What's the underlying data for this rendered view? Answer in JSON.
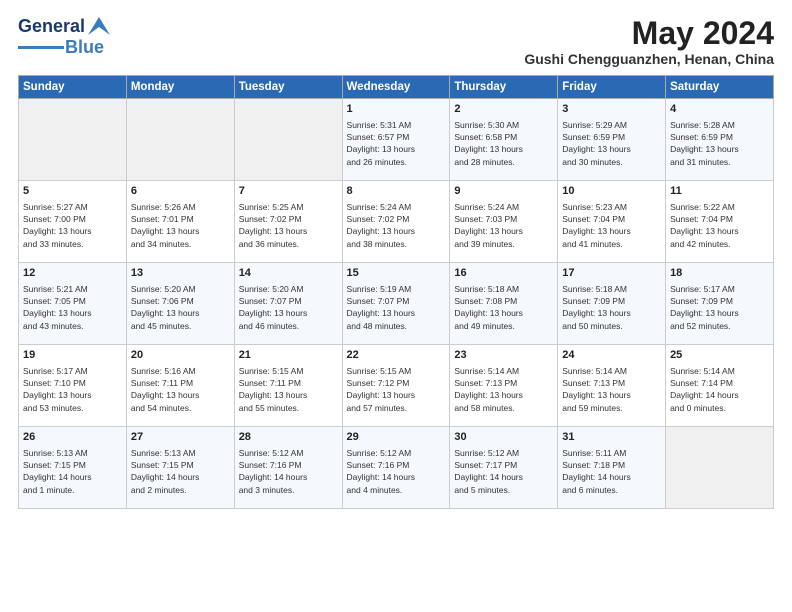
{
  "logo": {
    "general": "General",
    "blue": "Blue"
  },
  "header": {
    "month": "May 2024",
    "location": "Gushi Chengguanzhen, Henan, China"
  },
  "weekdays": [
    "Sunday",
    "Monday",
    "Tuesday",
    "Wednesday",
    "Thursday",
    "Friday",
    "Saturday"
  ],
  "weeks": [
    [
      {
        "day": "",
        "info": ""
      },
      {
        "day": "",
        "info": ""
      },
      {
        "day": "",
        "info": ""
      },
      {
        "day": "1",
        "info": "Sunrise: 5:31 AM\nSunset: 6:57 PM\nDaylight: 13 hours\nand 26 minutes."
      },
      {
        "day": "2",
        "info": "Sunrise: 5:30 AM\nSunset: 6:58 PM\nDaylight: 13 hours\nand 28 minutes."
      },
      {
        "day": "3",
        "info": "Sunrise: 5:29 AM\nSunset: 6:59 PM\nDaylight: 13 hours\nand 30 minutes."
      },
      {
        "day": "4",
        "info": "Sunrise: 5:28 AM\nSunset: 6:59 PM\nDaylight: 13 hours\nand 31 minutes."
      }
    ],
    [
      {
        "day": "5",
        "info": "Sunrise: 5:27 AM\nSunset: 7:00 PM\nDaylight: 13 hours\nand 33 minutes."
      },
      {
        "day": "6",
        "info": "Sunrise: 5:26 AM\nSunset: 7:01 PM\nDaylight: 13 hours\nand 34 minutes."
      },
      {
        "day": "7",
        "info": "Sunrise: 5:25 AM\nSunset: 7:02 PM\nDaylight: 13 hours\nand 36 minutes."
      },
      {
        "day": "8",
        "info": "Sunrise: 5:24 AM\nSunset: 7:02 PM\nDaylight: 13 hours\nand 38 minutes."
      },
      {
        "day": "9",
        "info": "Sunrise: 5:24 AM\nSunset: 7:03 PM\nDaylight: 13 hours\nand 39 minutes."
      },
      {
        "day": "10",
        "info": "Sunrise: 5:23 AM\nSunset: 7:04 PM\nDaylight: 13 hours\nand 41 minutes."
      },
      {
        "day": "11",
        "info": "Sunrise: 5:22 AM\nSunset: 7:04 PM\nDaylight: 13 hours\nand 42 minutes."
      }
    ],
    [
      {
        "day": "12",
        "info": "Sunrise: 5:21 AM\nSunset: 7:05 PM\nDaylight: 13 hours\nand 43 minutes."
      },
      {
        "day": "13",
        "info": "Sunrise: 5:20 AM\nSunset: 7:06 PM\nDaylight: 13 hours\nand 45 minutes."
      },
      {
        "day": "14",
        "info": "Sunrise: 5:20 AM\nSunset: 7:07 PM\nDaylight: 13 hours\nand 46 minutes."
      },
      {
        "day": "15",
        "info": "Sunrise: 5:19 AM\nSunset: 7:07 PM\nDaylight: 13 hours\nand 48 minutes."
      },
      {
        "day": "16",
        "info": "Sunrise: 5:18 AM\nSunset: 7:08 PM\nDaylight: 13 hours\nand 49 minutes."
      },
      {
        "day": "17",
        "info": "Sunrise: 5:18 AM\nSunset: 7:09 PM\nDaylight: 13 hours\nand 50 minutes."
      },
      {
        "day": "18",
        "info": "Sunrise: 5:17 AM\nSunset: 7:09 PM\nDaylight: 13 hours\nand 52 minutes."
      }
    ],
    [
      {
        "day": "19",
        "info": "Sunrise: 5:17 AM\nSunset: 7:10 PM\nDaylight: 13 hours\nand 53 minutes."
      },
      {
        "day": "20",
        "info": "Sunrise: 5:16 AM\nSunset: 7:11 PM\nDaylight: 13 hours\nand 54 minutes."
      },
      {
        "day": "21",
        "info": "Sunrise: 5:15 AM\nSunset: 7:11 PM\nDaylight: 13 hours\nand 55 minutes."
      },
      {
        "day": "22",
        "info": "Sunrise: 5:15 AM\nSunset: 7:12 PM\nDaylight: 13 hours\nand 57 minutes."
      },
      {
        "day": "23",
        "info": "Sunrise: 5:14 AM\nSunset: 7:13 PM\nDaylight: 13 hours\nand 58 minutes."
      },
      {
        "day": "24",
        "info": "Sunrise: 5:14 AM\nSunset: 7:13 PM\nDaylight: 13 hours\nand 59 minutes."
      },
      {
        "day": "25",
        "info": "Sunrise: 5:14 AM\nSunset: 7:14 PM\nDaylight: 14 hours\nand 0 minutes."
      }
    ],
    [
      {
        "day": "26",
        "info": "Sunrise: 5:13 AM\nSunset: 7:15 PM\nDaylight: 14 hours\nand 1 minute."
      },
      {
        "day": "27",
        "info": "Sunrise: 5:13 AM\nSunset: 7:15 PM\nDaylight: 14 hours\nand 2 minutes."
      },
      {
        "day": "28",
        "info": "Sunrise: 5:12 AM\nSunset: 7:16 PM\nDaylight: 14 hours\nand 3 minutes."
      },
      {
        "day": "29",
        "info": "Sunrise: 5:12 AM\nSunset: 7:16 PM\nDaylight: 14 hours\nand 4 minutes."
      },
      {
        "day": "30",
        "info": "Sunrise: 5:12 AM\nSunset: 7:17 PM\nDaylight: 14 hours\nand 5 minutes."
      },
      {
        "day": "31",
        "info": "Sunrise: 5:11 AM\nSunset: 7:18 PM\nDaylight: 14 hours\nand 6 minutes."
      },
      {
        "day": "",
        "info": ""
      }
    ]
  ]
}
